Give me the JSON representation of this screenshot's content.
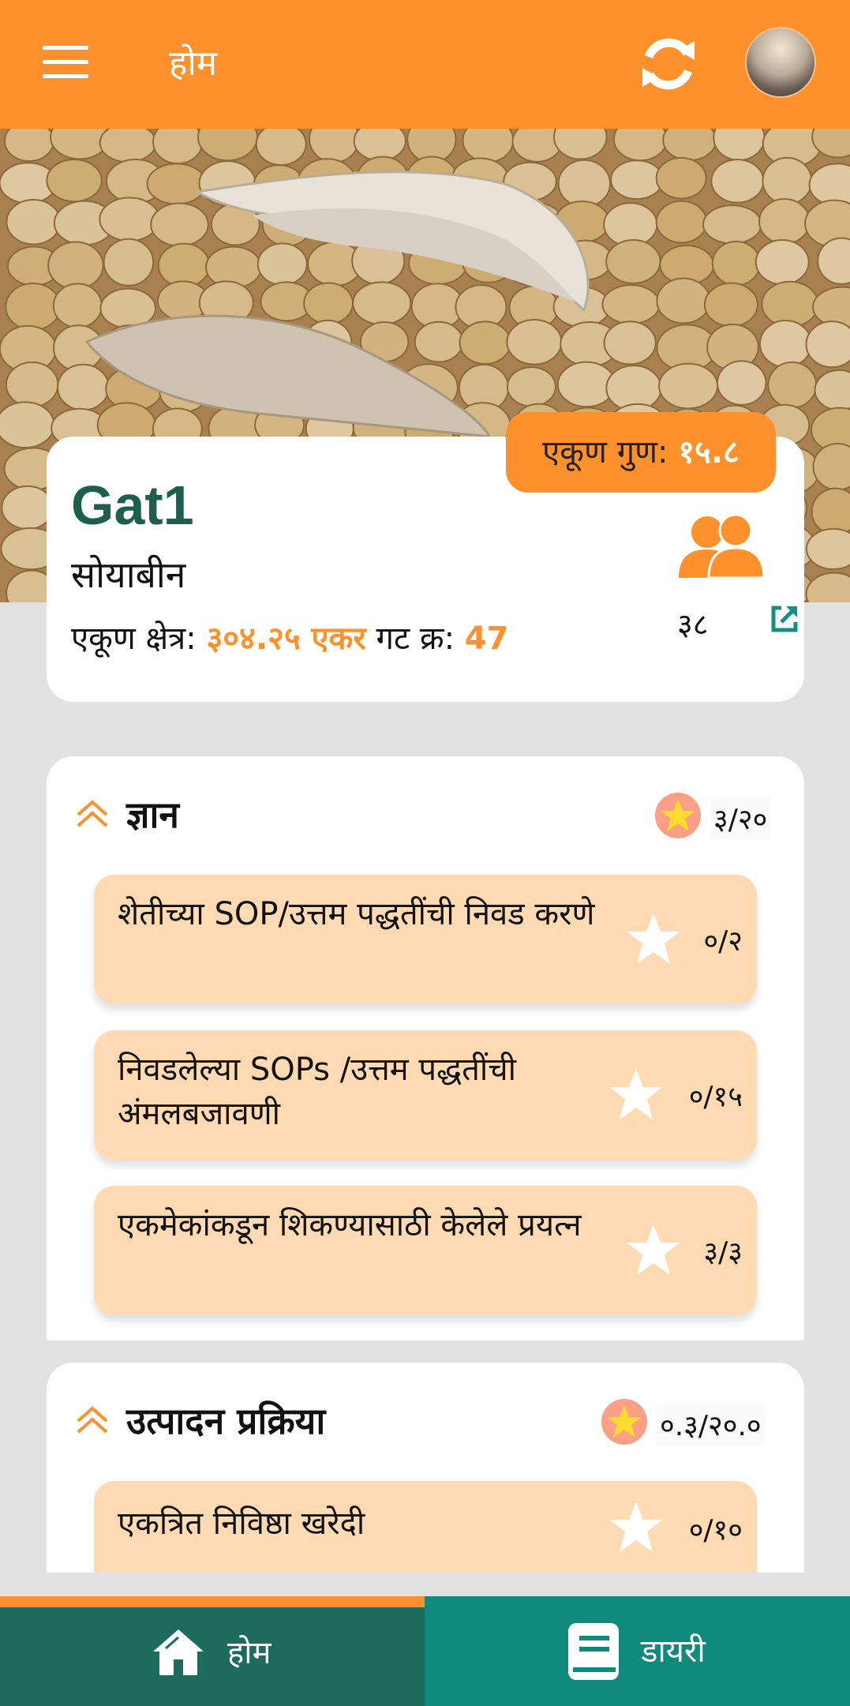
{
  "header": {
    "title": "होम"
  },
  "crop_card": {
    "score_label": "एकूण गुण:",
    "score_value": "१५.८",
    "group_name": "Gat1",
    "crop": "सोयाबीन",
    "area_label": "एकूण क्षेत्र:",
    "area_value": "३०४.२५ एकर",
    "group_no_label": "गट क्र:",
    "group_no_value": "47",
    "member_count": "३८"
  },
  "sections": [
    {
      "title": "ज्ञान",
      "score": "३/२०",
      "items": [
        {
          "label": "शेतीच्या SOP/उत्तम पद्धतींची निवड करणे",
          "score": "०/२"
        },
        {
          "label": "निवडलेल्या SOPs /उत्तम पद्धतींची अंमलबजावणी",
          "score": "०/१५"
        },
        {
          "label": "एकमेकांकडून शिकण्यासाठी केलेले प्रयत्न",
          "score": "३/३"
        }
      ]
    },
    {
      "title": "उत्पादन प्रक्रिया",
      "score": "०.३/२०.०",
      "items": [
        {
          "label": "एकत्रित निविष्ठा खरेदी",
          "score": "०/१०"
        }
      ]
    }
  ],
  "bottom_nav": {
    "home_label": "होम",
    "diary_label": "डायरी"
  },
  "colors": {
    "primary_orange": "#fe912b",
    "card_peach": "#ffdab2",
    "group_green": "#1e5e4c",
    "nav_dark_teal": "#1c6b5d",
    "nav_teal": "#118a7e"
  },
  "icons": [
    "menu-icon",
    "refresh-icon",
    "avatar",
    "people-icon",
    "external-link-icon",
    "chevron-up-icon",
    "star-icon",
    "home-icon",
    "book-icon"
  ]
}
